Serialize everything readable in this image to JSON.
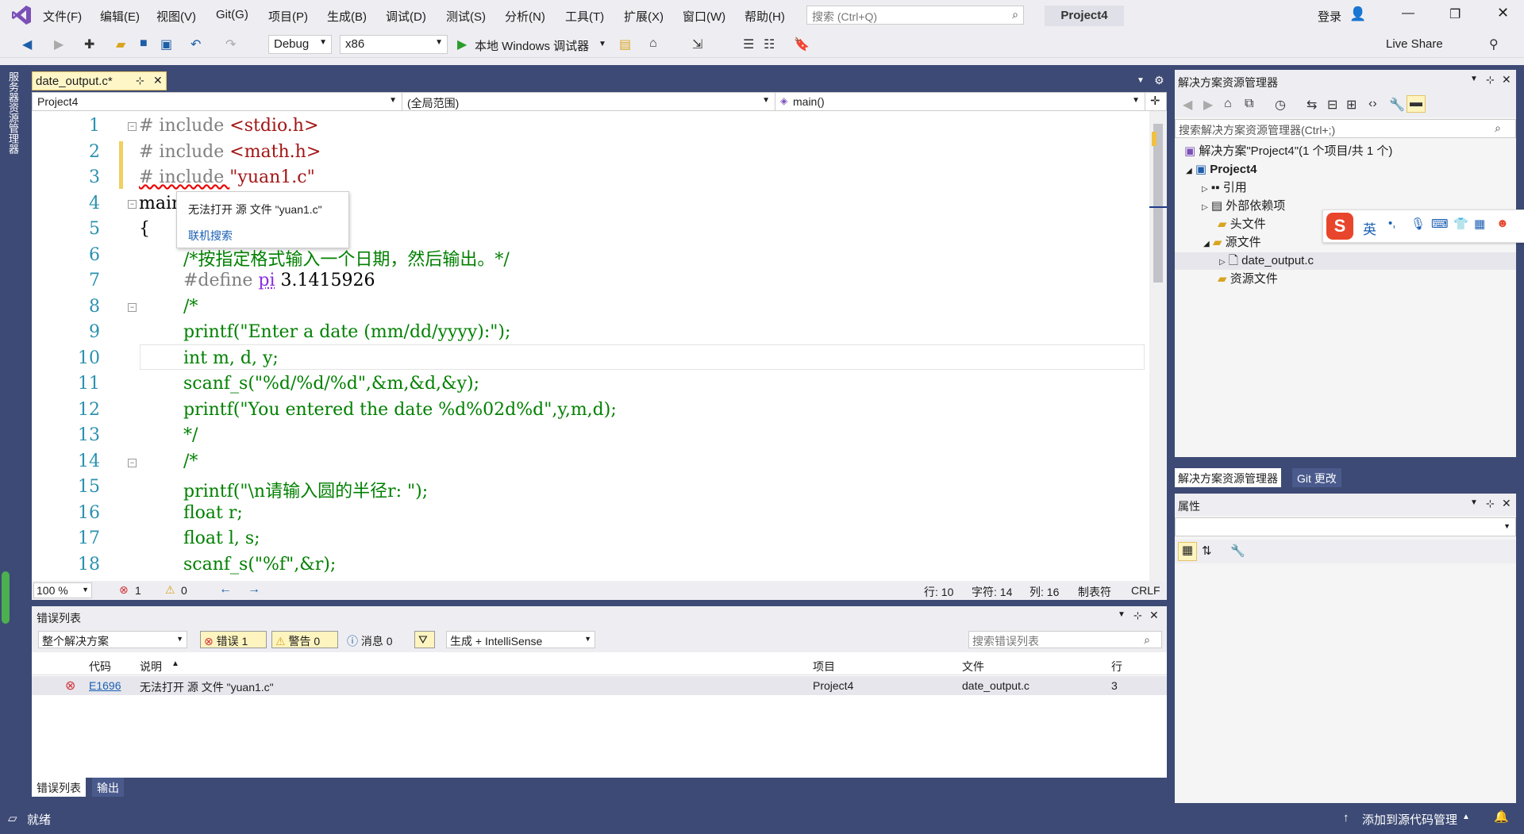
{
  "menu": {
    "items": [
      "文件(F)",
      "编辑(E)",
      "视图(V)",
      "Git(G)",
      "项目(P)",
      "生成(B)",
      "调试(D)",
      "测试(S)",
      "分析(N)",
      "工具(T)",
      "扩展(X)",
      "窗口(W)",
      "帮助(H)"
    ],
    "search_placeholder": "搜索 (Ctrl+Q)",
    "project_title": "Project4",
    "login": "登录",
    "live_share": "Live Share"
  },
  "toolbar": {
    "config": "Debug",
    "platform": "x86",
    "run_label": "本地 Windows 调试器"
  },
  "side_strip": {
    "label": "服务器资源管理器"
  },
  "editor": {
    "tab_label": "date_output.c*",
    "nav_project": "Project4",
    "nav_scope": "(全局范围)",
    "nav_function": "main()",
    "line_numbers": [
      "1",
      "2",
      "3",
      "4",
      "5",
      "6",
      "7",
      "8",
      "9",
      "10",
      "11",
      "12",
      "13",
      "14",
      "15",
      "16",
      "17",
      "18"
    ],
    "code": {
      "l1a": "# include ",
      "l1b": "<stdio.h>",
      "l2a": "# include ",
      "l2b": "<math.h>",
      "l3a": "# include ",
      "l3b": "\"yuan1.c\"",
      "l4": "main",
      "l5": "{",
      "l6": "/*按指定格式输入一个日期，然后输出。*/",
      "l7a": "#define ",
      "l7b": "pi",
      "l7c": " 3.1415926",
      "l8": "/*",
      "l9": "printf(\"Enter a date (mm/dd/yyyy):\");",
      "l10": "int m, d, y;",
      "l11": "scanf_s(\"%d/%d/%d\",&m,&d,&y);",
      "l12": "printf(\"You entered the date %d%02d%d\",y,m,d);",
      "l13": "*/",
      "l14": "/*",
      "l15": "printf(\"\\n请输入圆的半径r: \");",
      "l16": "float r;",
      "l17": "float l, s;",
      "l18": "scanf_s(\"%f\",&r);"
    },
    "tooltip": {
      "message": "无法打开 源 文件 \"yuan1.c\"",
      "link": "联机搜索"
    },
    "status": {
      "zoom": "100 %",
      "errors": "1",
      "warnings": "0",
      "line": "行: 10",
      "char": "字符: 14",
      "col": "列: 16",
      "tab": "制表符",
      "eol": "CRLF"
    }
  },
  "error_list": {
    "title": "错误列表",
    "scope": "整个解决方案",
    "errors_btn": "错误 1",
    "warnings_btn": "警告 0",
    "messages_btn": "消息 0",
    "build_filter": "生成 + IntelliSense",
    "search_placeholder": "搜索错误列表",
    "headers": {
      "code": "代码",
      "desc": "说明",
      "project": "项目",
      "file": "文件",
      "line": "行"
    },
    "rows": [
      {
        "code": "E1696",
        "desc": "无法打开 源 文件 \"yuan1.c\"",
        "project": "Project4",
        "file": "date_output.c",
        "line": "3"
      }
    ],
    "tabs": [
      "错误列表",
      "输出"
    ]
  },
  "solution": {
    "title": "解决方案资源管理器",
    "search_placeholder": "搜索解决方案资源管理器(Ctrl+;)",
    "tree": {
      "solution": "解决方案\"Project4\"(1 个项目/共 1 个)",
      "project": "Project4",
      "references": "引用",
      "external": "外部依赖项",
      "headers": "头文件",
      "sources": "源文件",
      "file": "date_output.c",
      "resources": "资源文件"
    },
    "tabs": [
      "解决方案资源管理器",
      "Git 更改"
    ]
  },
  "properties": {
    "title": "属性"
  },
  "ime": {
    "lang": "英"
  },
  "statusbar": {
    "ready": "就绪",
    "source_control": "添加到源代码管理"
  },
  "colors": {
    "frame": "#3d4a75",
    "accent": "#007acc"
  }
}
